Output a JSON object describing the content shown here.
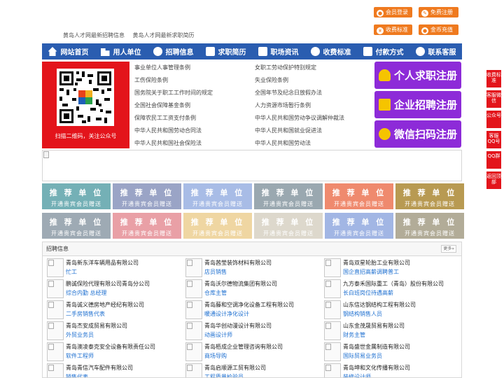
{
  "top_buttons": {
    "member_login": "会员登录",
    "free_register": "免费注册",
    "fee_standard": "收费标准",
    "coin_recharge": "金币充值"
  },
  "top_links": [
    "黄岛人才网最新招聘信息",
    "黄岛人才网最新求职简历"
  ],
  "nav": [
    {
      "label": "网站首页",
      "icon": "home-icon"
    },
    {
      "label": "用人单位",
      "icon": "building-icon"
    },
    {
      "label": "招聘信息",
      "icon": "recruit-icon"
    },
    {
      "label": "求职简历",
      "icon": "resume-icon"
    },
    {
      "label": "职场资讯",
      "icon": "news-icon"
    },
    {
      "label": "收费标准",
      "icon": "fee-icon"
    },
    {
      "label": "付款方式",
      "icon": "payment-icon"
    },
    {
      "label": "联系客服",
      "icon": "phone-icon"
    }
  ],
  "qr": {
    "caption": "扫描二维码，关注公众号"
  },
  "laws": {
    "left": [
      "事业单位人事管理条例",
      "工伤保险条例",
      "国务院关于职工工作时间的规定",
      "全国社会保障基金条例",
      "保障农民工工资支付条例",
      "中华人民共和国劳动合同法",
      "中华人民共和国社会保险法"
    ],
    "right": [
      "女职工劳动保护特别规定",
      "失业保险条例",
      "全国年节及纪念日放假办法",
      "人力资源市场暂行条例",
      "中华人民共和国劳动争议调解仲裁法",
      "中华人民共和国就业促进法",
      "中华人民共和国劳动法"
    ]
  },
  "register": {
    "job_seeker": "个人求职注册",
    "company": "企业招聘注册",
    "wechat": "微信扫码注册"
  },
  "tiles": {
    "title": "推 荐 单 位",
    "subtitle": "开通贵宾会员赠送",
    "row1_colors": [
      "#74b0b6",
      "#9aa4c6",
      "#a8bce6",
      "#9aa8b0",
      "#ef8a6e",
      "#b89a52"
    ],
    "row2_colors": [
      "#9eaab4",
      "#e9a0a6",
      "#efd6a2",
      "#ddd8cc",
      "#a2b6e4",
      "#b2ac98"
    ]
  },
  "jobs": {
    "title": "招聘信息",
    "more": "更多»",
    "columns": [
      [
        {
          "company": "青岛新东洋车辆用品有限公司",
          "position": "忙工"
        },
        {
          "company": "鹏诚保险代理有限公司青岛分公司",
          "position": "综合内勤 总经理"
        },
        {
          "company": "青岛诚义德房地产经纪有限公司",
          "position": "二手房销售代表"
        },
        {
          "company": "青岛杰安成贸易有限公司",
          "position": "外贸业务员"
        },
        {
          "company": "青岛澳凌泰克安全设备有限责任公司",
          "position": "软件工程师"
        },
        {
          "company": "青岛青信汽车配件有限公司",
          "position": "销售代表"
        }
      ],
      [
        {
          "company": "青岛茜莹装饰材料有限公司",
          "position": "店员销售"
        },
        {
          "company": "青岛沃尔德物流集团有限公司",
          "position": "仓库主管"
        },
        {
          "company": "青岛藤和空调净化设备工程有限公司",
          "position": "暖通设计净化设计"
        },
        {
          "company": "青岛华创动漫设计有限公司",
          "position": "动画设计师"
        },
        {
          "company": "青岛栢成企业管理咨询有限公司",
          "position": "商场导购"
        },
        {
          "company": "青岛启顺源工贸有限公司",
          "position": "工程质量检验员"
        }
      ],
      [
        {
          "company": "青岛双星轮胎工业有限公司",
          "position": "国企直招高薪调聘普工"
        },
        {
          "company": "九方泰禾国际重工（青岛）股份有限公司",
          "position": "长白班岗位待遇高薪"
        },
        {
          "company": "山东信达钢结构工程有限公司",
          "position": "钢结构销售人员"
        },
        {
          "company": "山东金茂晟贸易有限公司",
          "position": "财务主管"
        },
        {
          "company": "青岛盛世金属制造有限公司",
          "position": "国际贸易业务员"
        },
        {
          "company": "青岛坤和文化传播有限公司",
          "position": "装修设计师"
        }
      ]
    ]
  },
  "sidebar": [
    "收费标准",
    "客服微信",
    "公众号",
    "客服QQ号",
    "QQ群",
    "返回顶部"
  ]
}
